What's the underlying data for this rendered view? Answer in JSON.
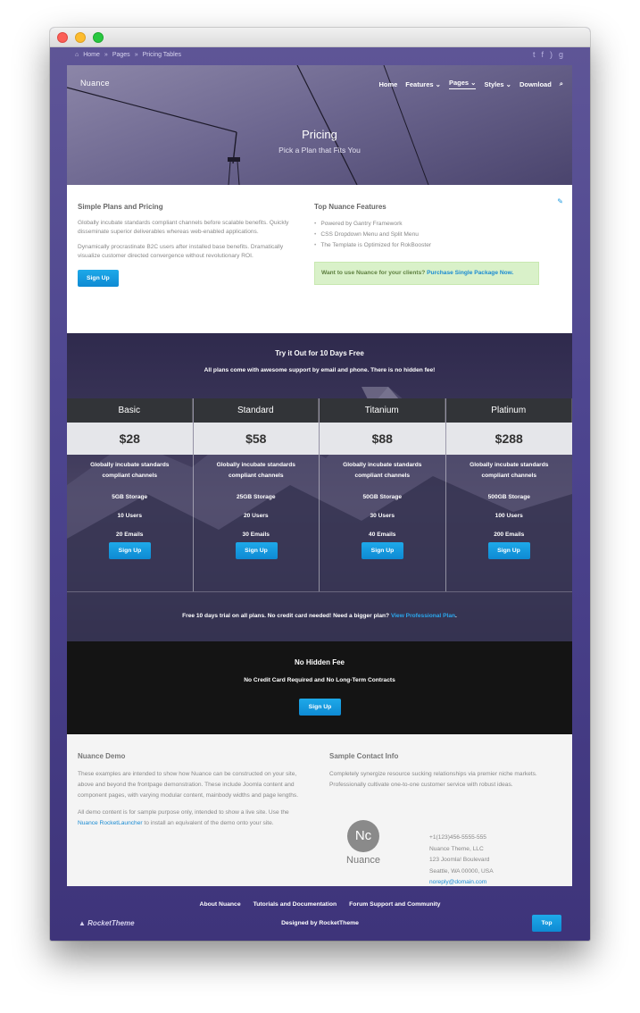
{
  "breadcrumb": {
    "items": [
      "Home",
      "Pages",
      "Pricing Tables"
    ]
  },
  "socials": [
    "twitter-icon",
    "facebook-icon",
    "rss-icon",
    "google-plus-icon"
  ],
  "header": {
    "logo": "Nuance",
    "nav": [
      "Home",
      "Features",
      "Pages",
      "Styles",
      "Download"
    ],
    "active_nav": "Pages"
  },
  "hero": {
    "title": "Pricing",
    "subtitle": "Pick a Plan that Fits You"
  },
  "intro": {
    "left_title": "Simple Plans and Pricing",
    "left_p1": "Globally incubate standards compliant channels before scalable benefits. Quickly disseminate superior deliverables whereas web-enabled applications.",
    "left_p2": "Dynamically procrastinate B2C users after installed base benefits. Dramatically visualize customer directed convergence without revolutionary ROI.",
    "signup_label": "Sign Up",
    "right_title": "Top Nuance Features",
    "features": [
      "Powered by Gantry Framework",
      "CSS Dropdown Menu and Split Menu",
      "The Template is Optimized for RokBooster"
    ],
    "callout_text": "Want to use Nuance for your clients?",
    "callout_link": "Purchase Single Package Now."
  },
  "pricing": {
    "title": "Try it Out for 10 Days Free",
    "subtitle": "All plans come with awesome support by email and phone. There is no hidden fee!",
    "plans": [
      {
        "name": "Basic",
        "price": "$28",
        "desc": "Globally incubate standards compliant channels",
        "storage": "5GB Storage",
        "users": "10 Users",
        "emails": "20 Emails",
        "button": "Sign Up"
      },
      {
        "name": "Standard",
        "price": "$58",
        "desc": "Globally incubate standards compliant channels",
        "storage": "25GB Storage",
        "users": "20 Users",
        "emails": "30 Emails",
        "button": "Sign Up"
      },
      {
        "name": "Titanium",
        "price": "$88",
        "desc": "Globally incubate standards compliant channels",
        "storage": "50GB Storage",
        "users": "30 Users",
        "emails": "40 Emails",
        "button": "Sign Up"
      },
      {
        "name": "Platinum",
        "price": "$288",
        "desc": "Globally incubate standards compliant channels",
        "storage": "500GB Storage",
        "users": "100 Users",
        "emails": "200 Emails",
        "button": "Sign Up"
      }
    ],
    "note_pre": "Free ",
    "note_bold": "10 days trial",
    "note_post": " on all plans. No credit card needed! Need a bigger plan?",
    "note_link": "View Professional Plan",
    "note_end": "."
  },
  "nofee": {
    "title": "No Hidden Fee",
    "subtitle": "No Credit Card Required and No Long-Term Contracts",
    "button": "Sign Up"
  },
  "footer_info": {
    "demo_title": "Nuance Demo",
    "demo_p1": "These examples are intended to show how Nuance can be constructed on your site, above and beyond the frontpage demonstration. These include Joomla content and component pages, with varying modular content, mainbody widths and page lengths.",
    "demo_p2_pre": "All demo content is for sample purpose only, intended to show a live site. Use the ",
    "demo_p2_link": "Nuance RocketLauncher",
    "demo_p2_post": " to install an equivalent of the demo onto your site.",
    "contact_title": "Sample Contact Info",
    "contact_p": "Completely synergize resource sucking relationships via premier niche markets. Professionally cultivate one-to-one customer service with robust ideas.",
    "logo_mark": "Nc",
    "logo_word": "Nuance",
    "phone": "+1(123)456-5555-555",
    "company": "Nuance Theme, LLC",
    "street": "123 Joomla! Boulevard",
    "city": "Seattle, WA 00000, USA",
    "email": "noreply@domain.com"
  },
  "site_footer": {
    "links": [
      "About Nuance",
      "Tutorials and Documentation",
      "Forum Support and Community"
    ],
    "brand": "RocketTheme",
    "designed_by": "Designed by RocketTheme",
    "top_label": "Top"
  }
}
